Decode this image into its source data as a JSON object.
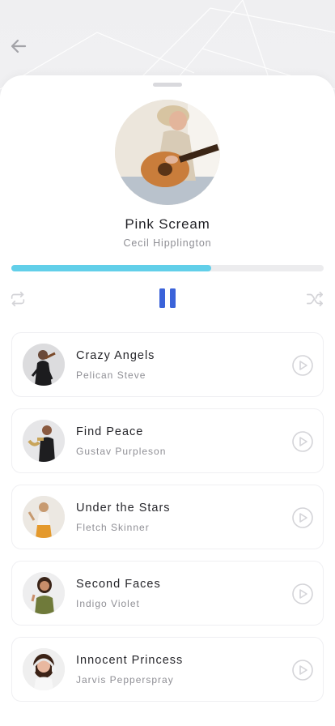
{
  "header": {
    "back_icon": "arrow-left-icon"
  },
  "now_playing": {
    "title": "Pink Scream",
    "artist": "Cecil Hipplington",
    "progress": 0.64,
    "controls": {
      "repeat_icon": "repeat-icon",
      "pause_icon": "pause-icon",
      "shuffle_icon": "shuffle-icon"
    }
  },
  "tracks": [
    {
      "title": "Crazy Angels",
      "artist": "Pelican Steve",
      "icon": "play-circle-icon"
    },
    {
      "title": "Find Peace",
      "artist": "Gustav Purpleson",
      "icon": "play-circle-icon"
    },
    {
      "title": "Under the Stars",
      "artist": "Fletch Skinner",
      "icon": "play-circle-icon"
    },
    {
      "title": "Second Faces",
      "artist": "Indigo Violet",
      "icon": "play-circle-icon"
    },
    {
      "title": "Innocent Princess",
      "artist": "Jarvis Pepperspray",
      "icon": "play-circle-icon"
    }
  ],
  "colors": {
    "accent_progress": "#62cfe9",
    "accent_control": "#3b63d9",
    "icon_muted": "#d4d4d8"
  }
}
